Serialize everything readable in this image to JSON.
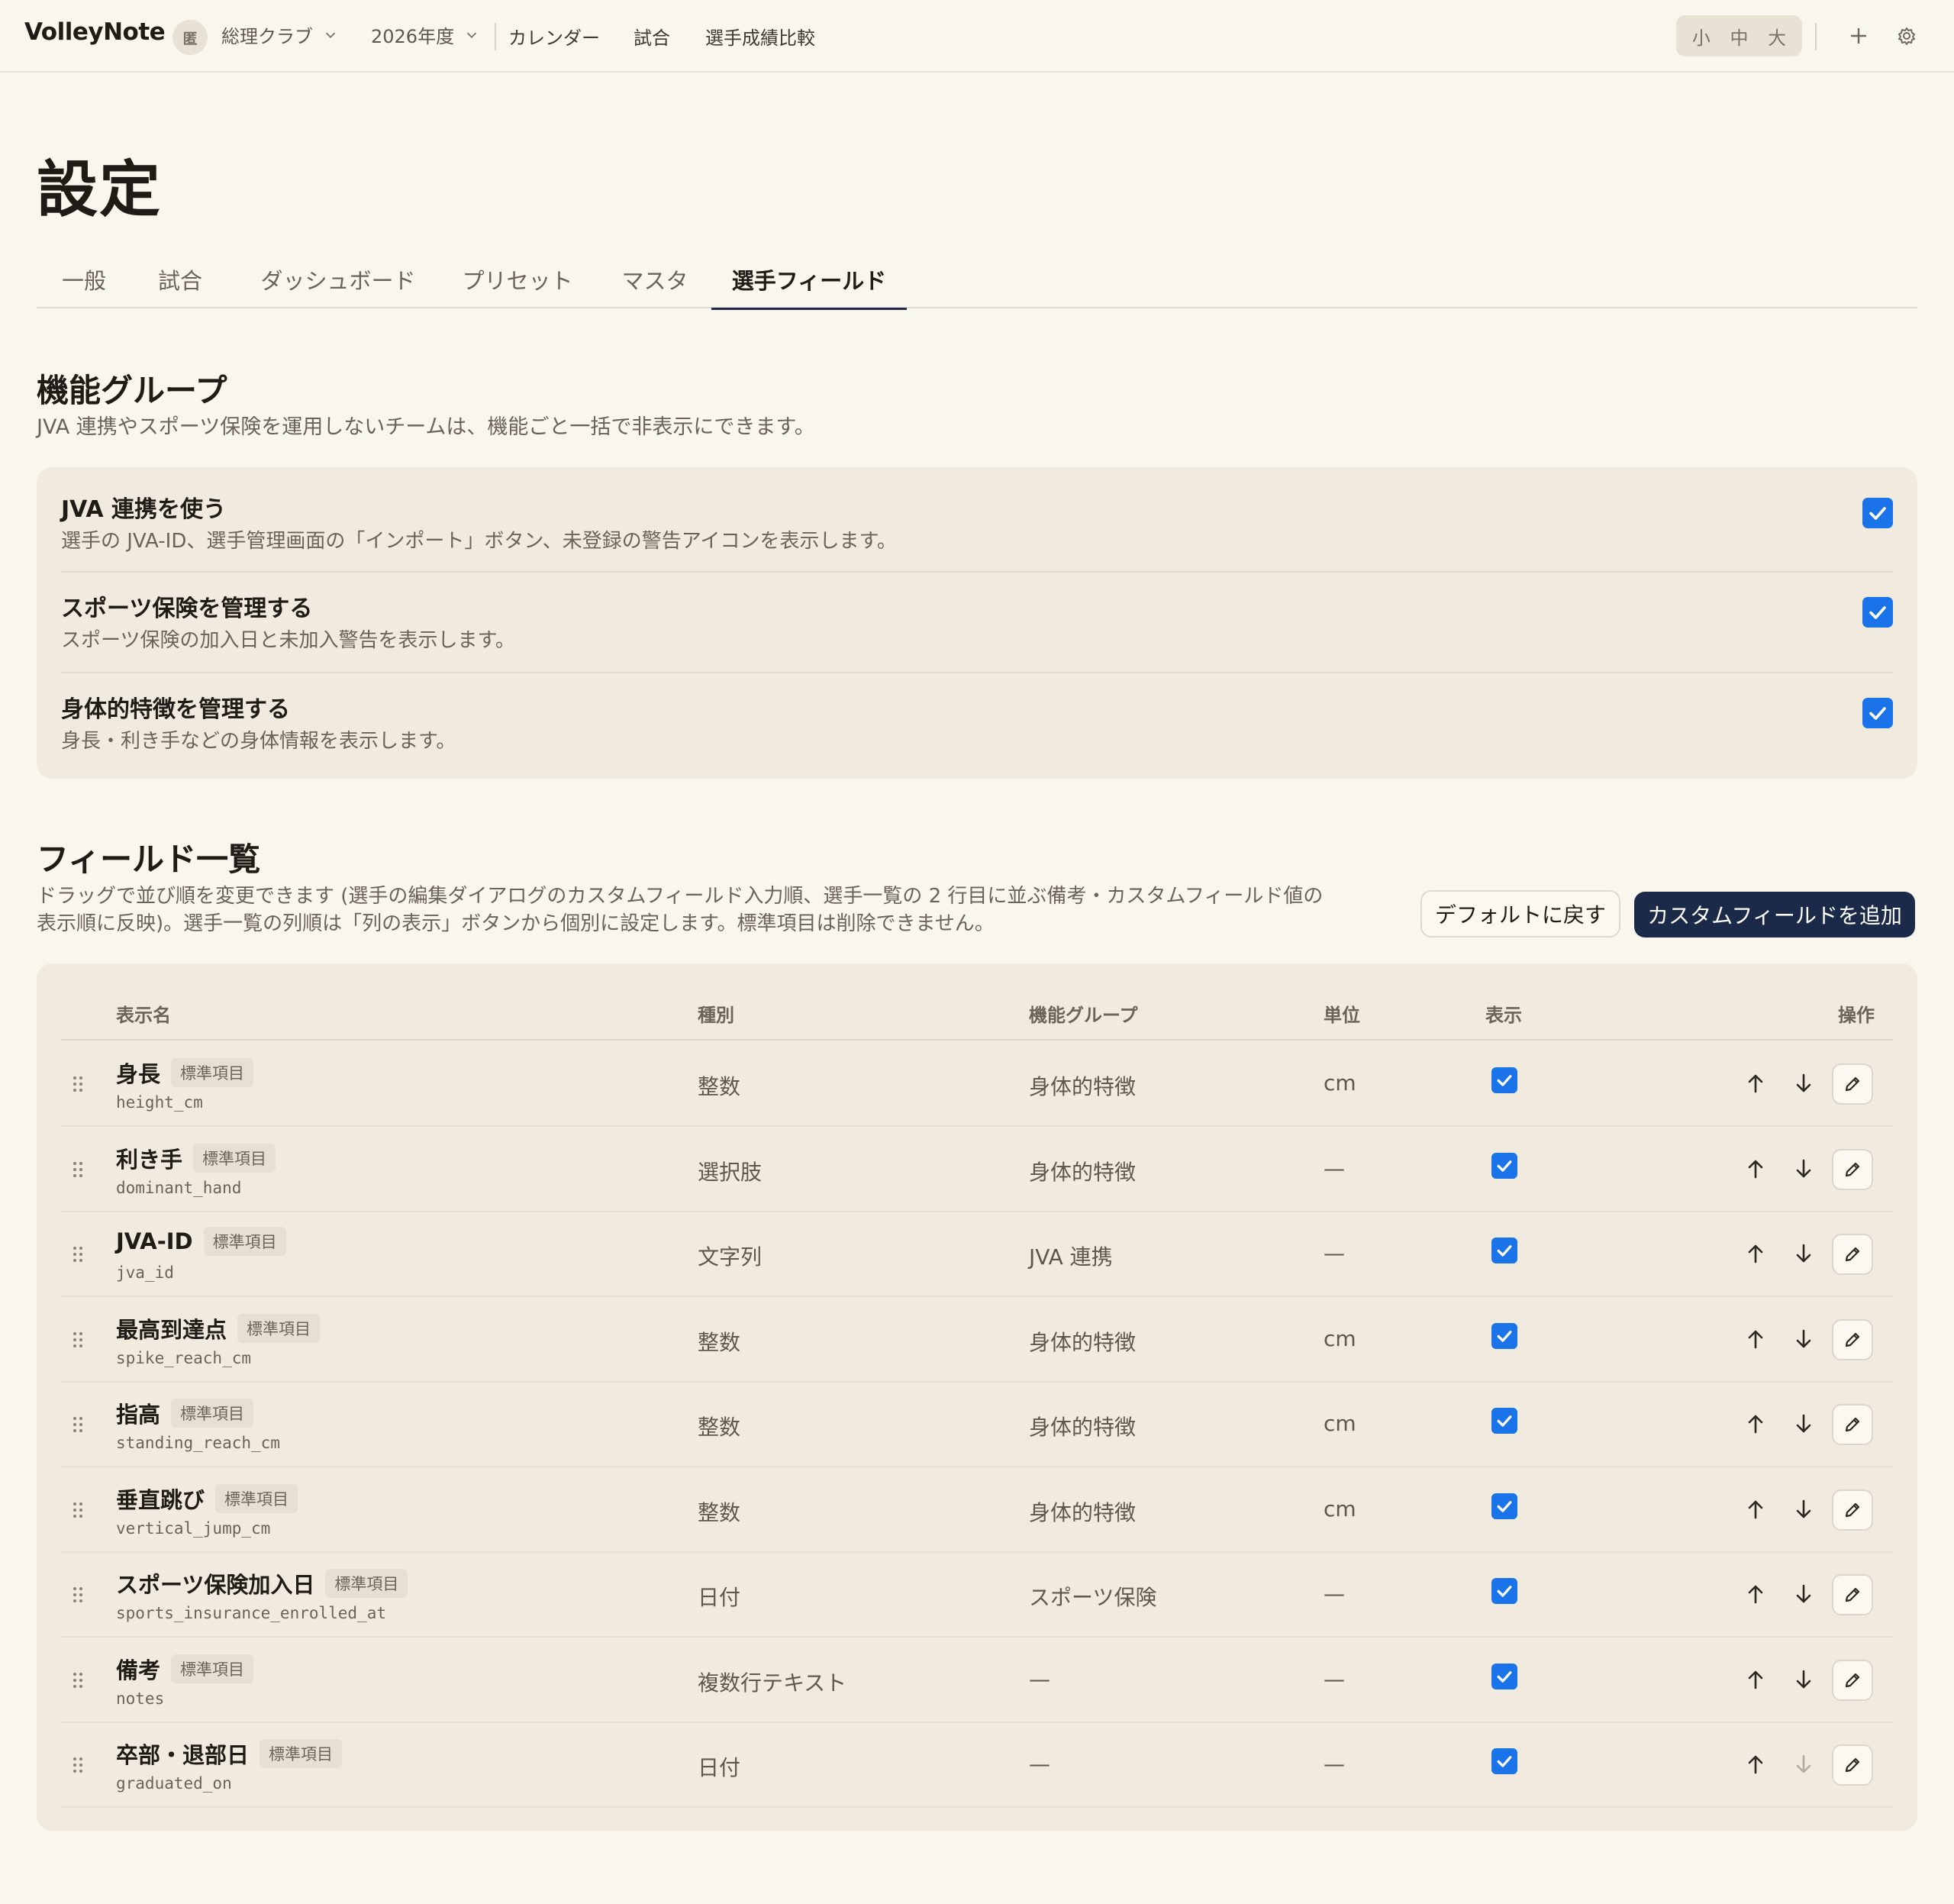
{
  "app": {
    "brand": "VolleyNote"
  },
  "topbar": {
    "team_avatar": "匿",
    "team_name": "総理クラブ",
    "year": "2026年度",
    "nav": [
      "カレンダー",
      "試合",
      "選手成績比較"
    ],
    "font_sizes": [
      "小",
      "中",
      "大"
    ]
  },
  "page": {
    "title": "設定",
    "tabs": [
      "一般",
      "試合",
      "ダッシュボード",
      "プリセット",
      "マスタ",
      "選手フィールド"
    ],
    "active_tab": "選手フィールド"
  },
  "feature_groups": {
    "title": "機能グループ",
    "description": "JVA 連携やスポーツ保険を運用しないチームは、機能ごと一括で非表示にできます。",
    "items": [
      {
        "title": "JVA 連携を使う",
        "description": "選手の JVA-ID、選手管理画面の「インポート」ボタン、未登録の警告アイコンを表示します。",
        "checked": true
      },
      {
        "title": "スポーツ保険を管理する",
        "description": "スポーツ保険の加入日と未加入警告を表示します。",
        "checked": true
      },
      {
        "title": "身体的特徴を管理する",
        "description": "身長・利き手などの身体情報を表示します。",
        "checked": true
      }
    ]
  },
  "fields": {
    "title": "フィールド一覧",
    "description_line1": "ドラッグで並び順を変更できます (選手の編集ダイアログのカスタムフィールド入力順、選手一覧の 2 行目に並ぶ備考・カスタムフィールド値の",
    "description_line2": "表示順に反映)。選手一覧の列順は「列の表示」ボタンから個別に設定します。標準項目は削除できません。",
    "reset_button": "デフォルトに戻す",
    "add_button": "カスタムフィールドを追加",
    "columns": {
      "name": "表示名",
      "type": "種別",
      "group": "機能グループ",
      "unit": "単位",
      "visible": "表示",
      "actions": "操作"
    },
    "rows": [
      {
        "name": "身長",
        "badge": "標準項目",
        "key": "height_cm",
        "type": "整数",
        "group": "身体的特徴",
        "unit": "cm",
        "visible": true
      },
      {
        "name": "利き手",
        "badge": "標準項目",
        "key": "dominant_hand",
        "type": "選択肢",
        "group": "身体的特徴",
        "unit": "—",
        "visible": true
      },
      {
        "name": "JVA-ID",
        "badge": "標準項目",
        "key": "jva_id",
        "type": "文字列",
        "group": "JVA 連携",
        "unit": "—",
        "visible": true
      },
      {
        "name": "最高到達点",
        "badge": "標準項目",
        "key": "spike_reach_cm",
        "type": "整数",
        "group": "身体的特徴",
        "unit": "cm",
        "visible": true
      },
      {
        "name": "指高",
        "badge": "標準項目",
        "key": "standing_reach_cm",
        "type": "整数",
        "group": "身体的特徴",
        "unit": "cm",
        "visible": true
      },
      {
        "name": "垂直跳び",
        "badge": "標準項目",
        "key": "vertical_jump_cm",
        "type": "整数",
        "group": "身体的特徴",
        "unit": "cm",
        "visible": true
      },
      {
        "name": "スポーツ保険加入日",
        "badge": "標準項目",
        "key": "sports_insurance_enrolled_at",
        "type": "日付",
        "group": "スポーツ保険",
        "unit": "—",
        "visible": true
      },
      {
        "name": "備考",
        "badge": "標準項目",
        "key": "notes",
        "type": "複数行テキスト",
        "group": "—",
        "unit": "—",
        "visible": true
      },
      {
        "name": "卒部・退部日",
        "badge": "標準項目",
        "key": "graduated_on",
        "type": "日付",
        "group": "—",
        "unit": "—",
        "visible": true
      }
    ]
  },
  "colors": {
    "accent": "#1a73e8",
    "primary_button": "#1c2a4a",
    "background": "#f9f6ee",
    "card": "#f1ebdf"
  }
}
